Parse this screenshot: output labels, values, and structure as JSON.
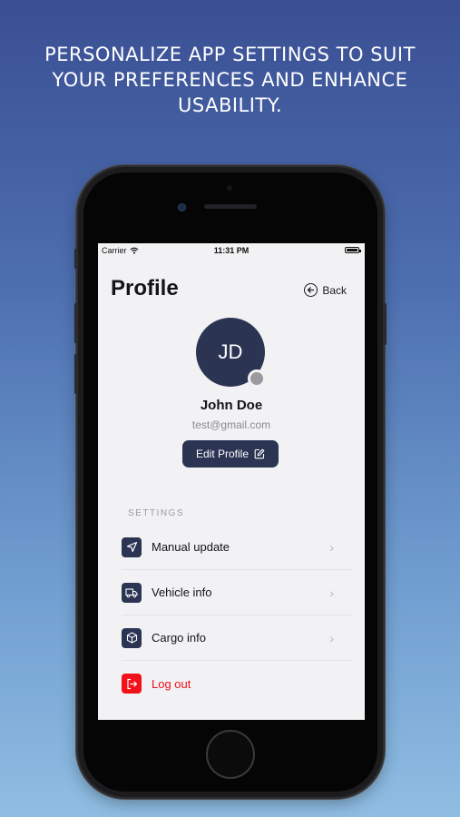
{
  "headline": "PERSONALIZE APP SETTINGS TO SUIT YOUR PREFERENCES AND ENHANCE USABILITY.",
  "status_bar": {
    "carrier": "Carrier",
    "time": "11:31 PM"
  },
  "header": {
    "title": "Profile",
    "back_label": "Back"
  },
  "profile": {
    "initials": "JD",
    "name": "John Doe",
    "email": "test@gmail.com",
    "edit_label": "Edit Profile"
  },
  "settings": {
    "section_label": "SETTINGS",
    "items": [
      {
        "label": "Manual update",
        "icon": "navigation-arrow-icon"
      },
      {
        "label": "Vehicle info",
        "icon": "truck-icon"
      },
      {
        "label": "Cargo info",
        "icon": "box-icon"
      },
      {
        "label": "Log out",
        "icon": "logout-icon"
      }
    ]
  },
  "colors": {
    "primary": "#2c3454",
    "danger": "#f2101a",
    "background": "#f2f2f4"
  }
}
